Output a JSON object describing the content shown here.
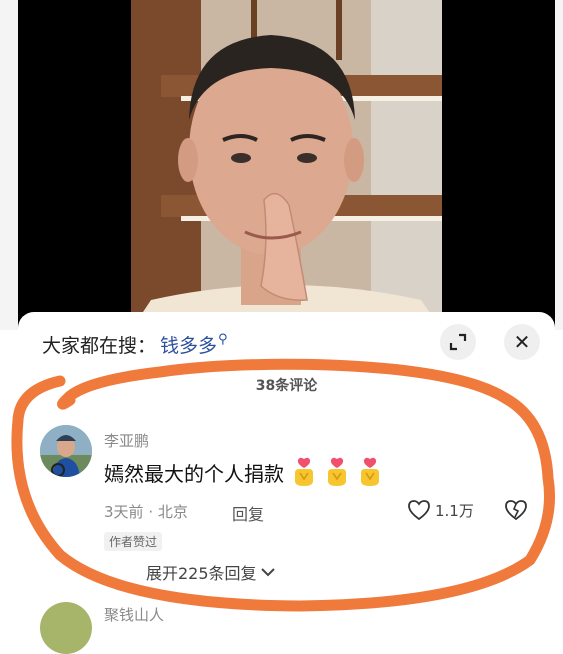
{
  "search": {
    "prefix": "大家都在搜：",
    "term": "钱多多"
  },
  "comments_header": {
    "count_text": "38条评论"
  },
  "comment": {
    "username": "李亚鹏",
    "text": "嫣然最大的个人捐款",
    "time": "3天前",
    "separator": "·",
    "location": "北京",
    "reply_label": "回复",
    "like_count": "1.1万",
    "author_badge": "作者赞过",
    "expand_label": "展开225条回复"
  },
  "next_comment": {
    "username": "聚钱山人"
  },
  "icons": [
    "search-icon",
    "expand-icon",
    "close-icon",
    "heart-icon",
    "dislike-icon",
    "chevron-down-icon",
    "heart-hands-emoji-icon"
  ],
  "colors": {
    "search_term": "#2c4f9e",
    "annotation": "#f07a3c"
  }
}
